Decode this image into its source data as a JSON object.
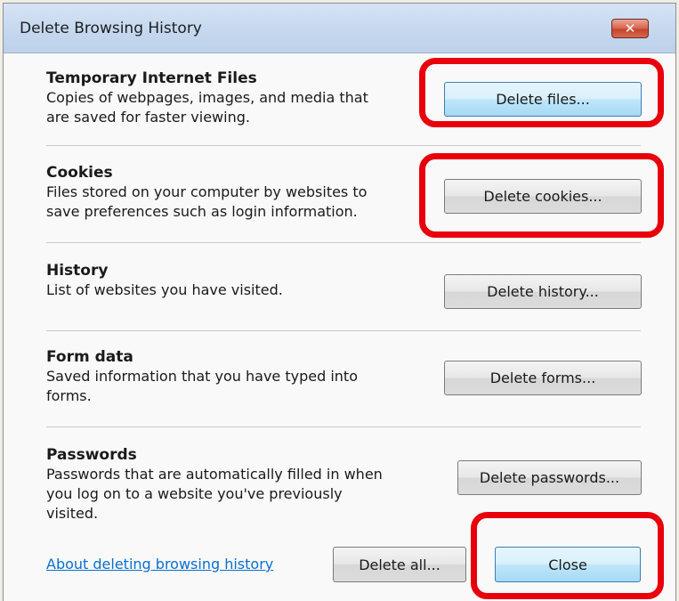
{
  "dialog": {
    "title": "Delete Browsing History",
    "close_glyph": "✕"
  },
  "sections": [
    {
      "title": "Temporary Internet Files",
      "desc_lines": [
        "Copies of webpages, images, and media that",
        "are saved for faster viewing."
      ],
      "button": "Delete files..."
    },
    {
      "title": "Cookies",
      "desc_lines": [
        "Files stored on your computer by websites to",
        "save preferences such as login information."
      ],
      "button": "Delete cookies..."
    },
    {
      "title": "History",
      "desc_lines": [
        "List of websites you have visited."
      ],
      "button": "Delete history..."
    },
    {
      "title": "Form data",
      "desc_lines": [
        "Saved information that you have typed into",
        "forms."
      ],
      "button": "Delete forms..."
    },
    {
      "title": "Passwords",
      "desc_lines": [
        "Passwords that are automatically filled in when",
        "you log on to a website you've previously",
        "visited."
      ],
      "button": "Delete passwords..."
    }
  ],
  "footer": {
    "link": "About deleting browsing history",
    "delete_all": "Delete all...",
    "close": "Close"
  },
  "colors": {
    "highlight": "#e8000b",
    "link": "#0b6fcf",
    "primary_button": "#a7d9f5"
  }
}
